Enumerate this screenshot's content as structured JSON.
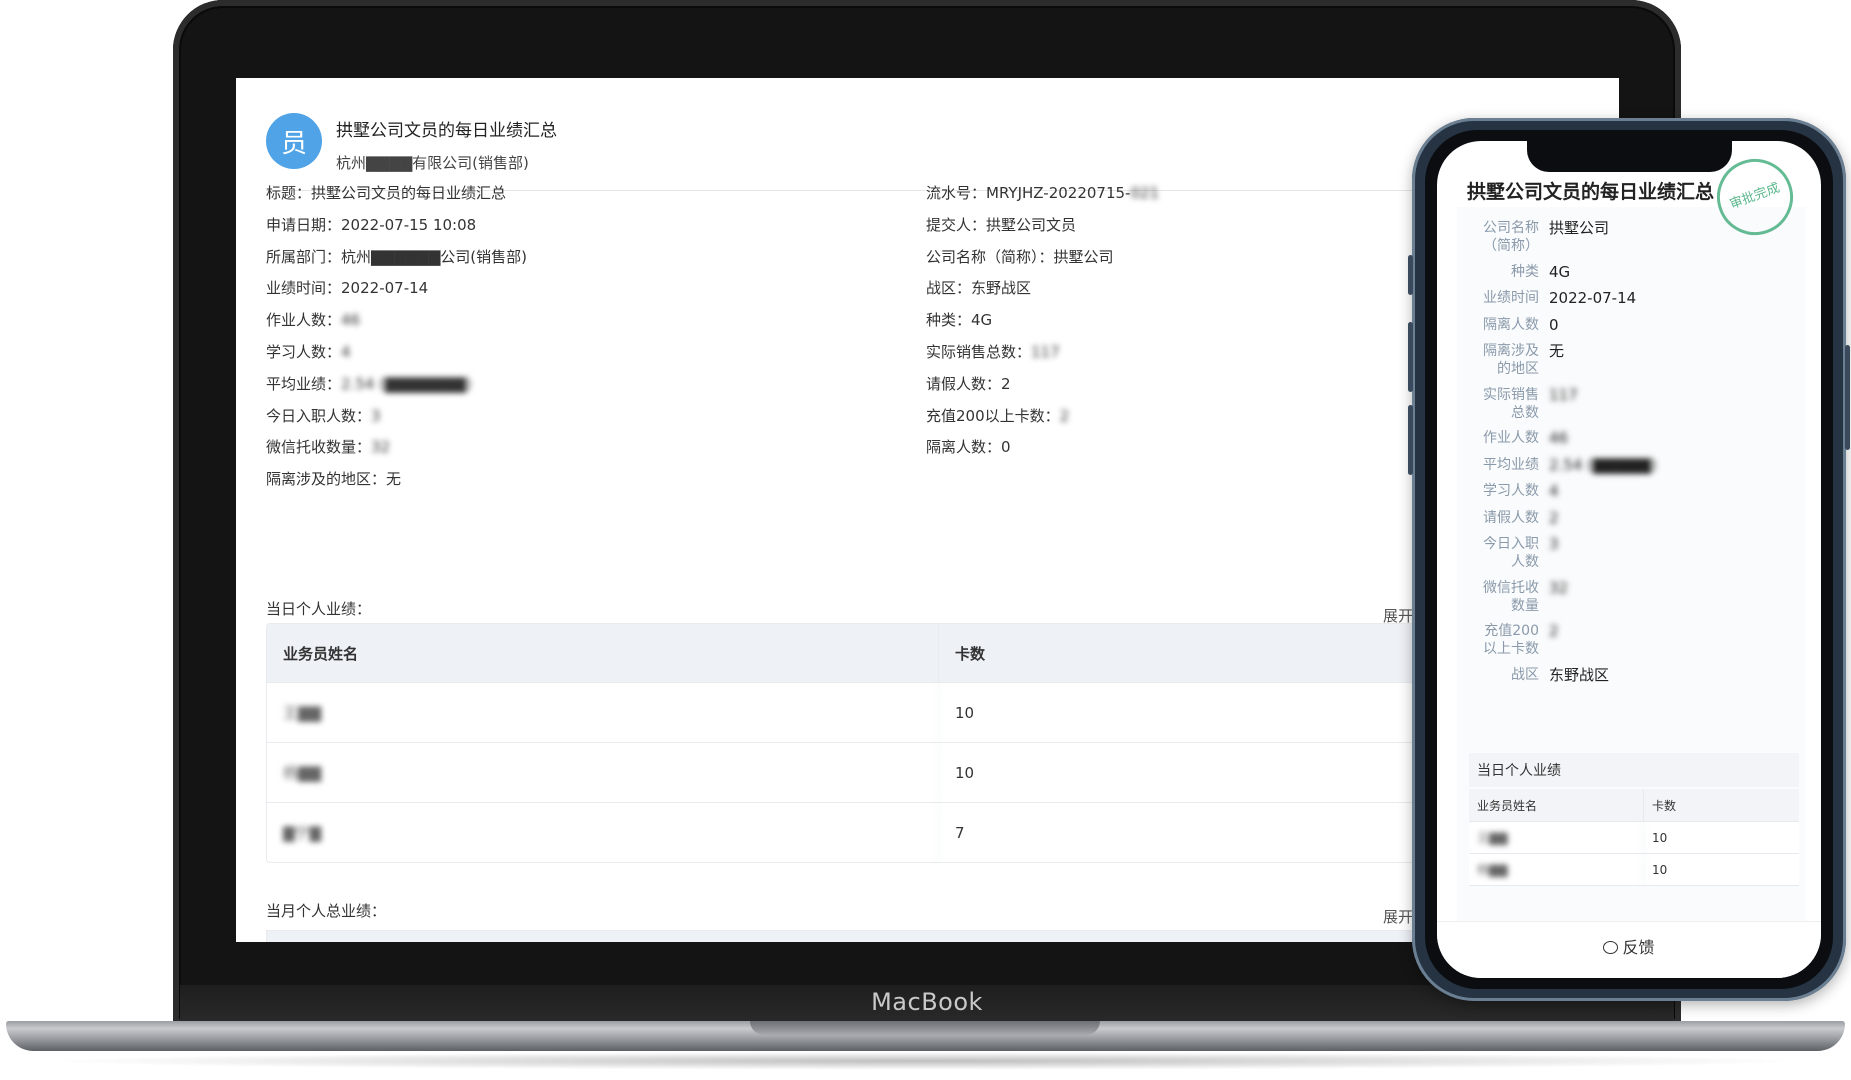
{
  "laptop": {
    "brand": "MacBook"
  },
  "screen": {
    "avatar_char": "员",
    "header_title": "拱墅公司文员的每日业绩汇总",
    "header_sub": "杭州▇▇▇▇有限公司(销售部)",
    "left_fields": [
      {
        "label": "标题：",
        "value": "拱墅公司文员的每日业绩汇总",
        "blur": false
      },
      {
        "label": "申请日期：",
        "value": "2022-07-15 10:08",
        "blur": false
      },
      {
        "label": "所属部门：",
        "value": "杭州▇▇▇▇▇▇公司(销售部)",
        "blur": false
      },
      {
        "label": "业绩时间：",
        "value": "2022-07-14",
        "blur": false
      },
      {
        "label": "作业人数：",
        "value": "46",
        "blur": true
      },
      {
        "label": "学习人数：",
        "value": "4",
        "blur": true
      },
      {
        "label": "平均业绩：",
        "value": "2.54 (▇▇▇▇▇▇▇)",
        "blur": true
      },
      {
        "label": "今日入职人数：",
        "value": "3",
        "blur": true
      },
      {
        "label": "微信托收数量：",
        "value": "32",
        "blur": true
      },
      {
        "label": "隔离涉及的地区：",
        "value": "无",
        "blur": false
      }
    ],
    "right_fields": [
      {
        "label": "流水号：",
        "value": "MRYJHZ-20220715-",
        "tail": "021"
      },
      {
        "label": "提交人：",
        "value": "拱墅公司文员",
        "tail": ""
      },
      {
        "label": "公司名称（简称）：",
        "value": "拱墅公司",
        "tail": ""
      },
      {
        "label": "战区：",
        "value": "东野战区",
        "tail": ""
      },
      {
        "label": "种类：",
        "value": "4G",
        "tail": ""
      },
      {
        "label": "实际销售总数：",
        "value": "",
        "tail": "117"
      },
      {
        "label": "请假人数：",
        "value": "2",
        "tail": ""
      },
      {
        "label": "充值200以上卡数：",
        "value": "",
        "tail": "2"
      },
      {
        "label": "隔离人数：",
        "value": "0",
        "tail": ""
      }
    ],
    "daily_section": "当日个人业绩：",
    "monthly_section": "当月个人总业绩：",
    "expand_label": "展开全",
    "table": {
      "headers": [
        "业务员姓名",
        "卡数"
      ],
      "rows": [
        {
          "name": "王▇▇",
          "cards": "10"
        },
        {
          "name": "杨▇▇",
          "cards": "10"
        },
        {
          "name": "▇宁▇",
          "cards": "7"
        }
      ]
    }
  },
  "phone": {
    "title": "拱墅公司文员的每日业绩汇总",
    "stamp_text": "审批完成",
    "fields": [
      {
        "label": "公司名称（简称）",
        "value": "拱墅公司",
        "blur": false
      },
      {
        "label": "种类",
        "value": "4G",
        "blur": false
      },
      {
        "label": "业绩时间",
        "value": "2022-07-14",
        "blur": false
      },
      {
        "label": "隔离人数",
        "value": "0",
        "blur": false
      },
      {
        "label": "隔离涉及的地区",
        "value": "无",
        "blur": false
      },
      {
        "label": "实际销售总数",
        "value": "117",
        "blur": true
      },
      {
        "label": "作业人数",
        "value": "46",
        "blur": true
      },
      {
        "label": "平均业绩",
        "value": "2.54 (▇▇▇▇▇)",
        "blur": true
      },
      {
        "label": "学习人数",
        "value": "4",
        "blur": true
      },
      {
        "label": "请假人数",
        "value": "2",
        "blur": true
      },
      {
        "label": "今日入职人数",
        "value": "3",
        "blur": true
      },
      {
        "label": "微信托收数量",
        "value": "32",
        "blur": true
      },
      {
        "label": "充值200以上卡数",
        "value": "2",
        "blur": true
      },
      {
        "label": "战区",
        "value": "东野战区",
        "blur": false
      }
    ],
    "section_title": "当日个人业绩",
    "table_headers": [
      "业务员姓名",
      "卡数"
    ],
    "table_rows": [
      {
        "name": "王▇▇",
        "cards": "10"
      },
      {
        "name": "杨▇▇",
        "cards": "10"
      }
    ],
    "feedback_label": "反馈"
  }
}
